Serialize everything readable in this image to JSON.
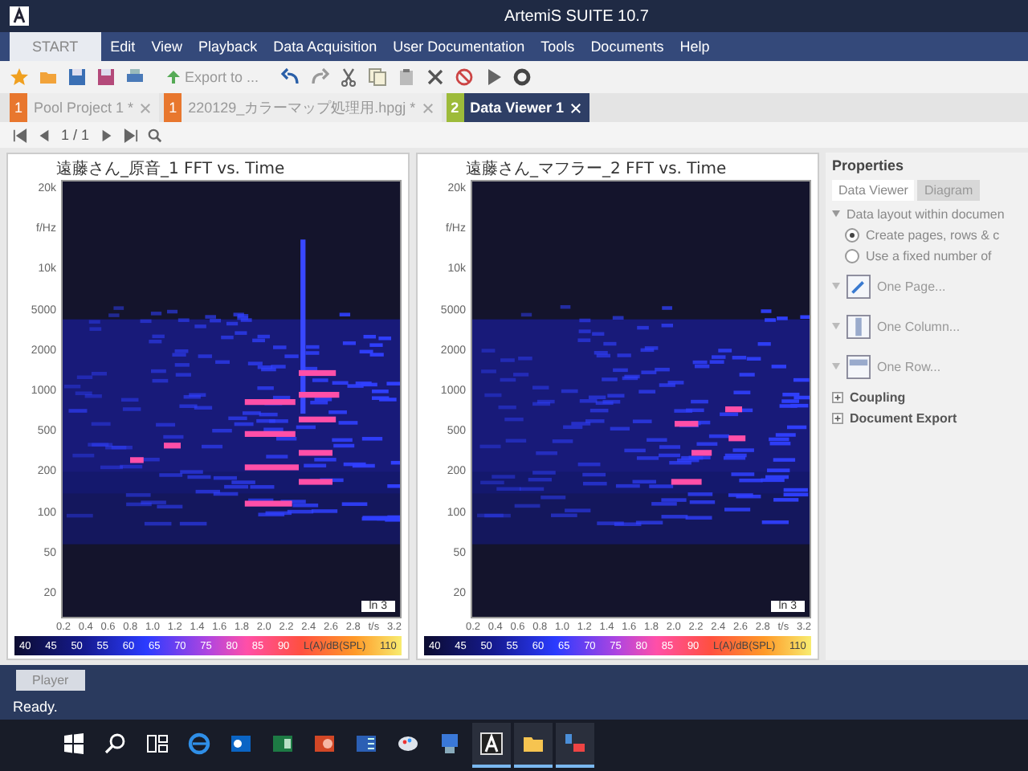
{
  "window": {
    "title": "ArtemiS SUITE 10.7"
  },
  "menu": [
    {
      "label": "START",
      "kind": "tab"
    },
    {
      "label": "Edit",
      "kind": "item"
    },
    {
      "label": "View",
      "kind": "item"
    },
    {
      "label": "Playback",
      "kind": "item"
    },
    {
      "label": "Data Acquisition",
      "kind": "item"
    },
    {
      "label": "User Documentation",
      "kind": "item"
    },
    {
      "label": "Tools",
      "kind": "item"
    },
    {
      "label": "Documents",
      "kind": "item"
    },
    {
      "label": "Help",
      "kind": "item"
    }
  ],
  "toolbar": {
    "export_button": "Export to ..."
  },
  "document_tabs": [
    {
      "number": "1",
      "label": "Pool Project 1 *",
      "selected": false,
      "color": "#e8772e"
    },
    {
      "number": "1",
      "label": "220129_カラーマップ処理用.hpgj *",
      "selected": false,
      "color": "#e8772e"
    },
    {
      "number": "2",
      "label": "Data Viewer 1",
      "selected": true,
      "color": "#9dbb3a"
    }
  ],
  "page_nav": {
    "page": "1 / 1"
  },
  "viewers": [
    {
      "title": "遠藤さん_原音_1 FFT vs. Time",
      "kind": "strong",
      "y_label": "f/Hz",
      "y_ticks": [
        "20k",
        "10k",
        "5000",
        "2000",
        "1000",
        "500",
        "200",
        "100",
        "50",
        "20"
      ],
      "x_ticks": [
        "0.2",
        "0.4",
        "0.6",
        "0.8",
        "1.0",
        "1.2",
        "1.4",
        "1.6",
        "1.8",
        "2.0",
        "2.2",
        "2.4",
        "2.6",
        "2.8"
      ],
      "x_unit": "t/s",
      "x_end": "3.2",
      "channel": "ln 3",
      "scale_ticks": [
        "40",
        "45",
        "50",
        "55",
        "60",
        "65",
        "70",
        "75",
        "80",
        "85",
        "90"
      ],
      "scale_label": "L(A)/dB(SPL)",
      "scale_end": "110"
    },
    {
      "title": "遠藤さん_マフラー_2 FFT vs. Time",
      "kind": "faint",
      "y_label": "f/Hz",
      "y_ticks": [
        "20k",
        "10k",
        "5000",
        "2000",
        "1000",
        "500",
        "200",
        "100",
        "50",
        "20"
      ],
      "x_ticks": [
        "0.2",
        "0.4",
        "0.6",
        "0.8",
        "1.0",
        "1.2",
        "1.4",
        "1.6",
        "1.8",
        "2.0",
        "2.2",
        "2.4",
        "2.6",
        "2.8"
      ],
      "x_unit": "t/s",
      "x_end": "3.2",
      "channel": "ln 3",
      "scale_ticks": [
        "40",
        "45",
        "50",
        "55",
        "60",
        "65",
        "70",
        "75",
        "80",
        "85",
        "90"
      ],
      "scale_label": "L(A)/dB(SPL)",
      "scale_end": "110"
    }
  ],
  "properties": {
    "title": "Properties",
    "tabs": [
      {
        "label": "Data Viewer",
        "selected": true
      },
      {
        "label": "Diagram",
        "selected": false
      }
    ],
    "layout_heading": "Data layout within documen",
    "options": [
      {
        "label": "Create pages, rows & c",
        "selected": true
      },
      {
        "label": "Use a fixed number of",
        "selected": false
      }
    ],
    "actions": [
      {
        "label": "One Page...",
        "kind": "page"
      },
      {
        "label": "One Column...",
        "kind": "column"
      },
      {
        "label": "One Row...",
        "kind": "row"
      }
    ],
    "sections": [
      "Coupling",
      "Document Export"
    ]
  },
  "player_button": "Player",
  "status": "Ready.",
  "taskbar": [
    {
      "kind": "start",
      "active": false
    },
    {
      "kind": "search",
      "active": false
    },
    {
      "kind": "taskview",
      "active": false
    },
    {
      "kind": "browser",
      "active": false
    },
    {
      "kind": "mail",
      "active": false
    },
    {
      "kind": "sheet",
      "active": false
    },
    {
      "kind": "slides",
      "active": false
    },
    {
      "kind": "doc",
      "active": false
    },
    {
      "kind": "paint",
      "active": false
    },
    {
      "kind": "network",
      "active": false
    },
    {
      "kind": "app",
      "active": true
    },
    {
      "kind": "folder",
      "active": true
    },
    {
      "kind": "tool",
      "active": true
    }
  ]
}
